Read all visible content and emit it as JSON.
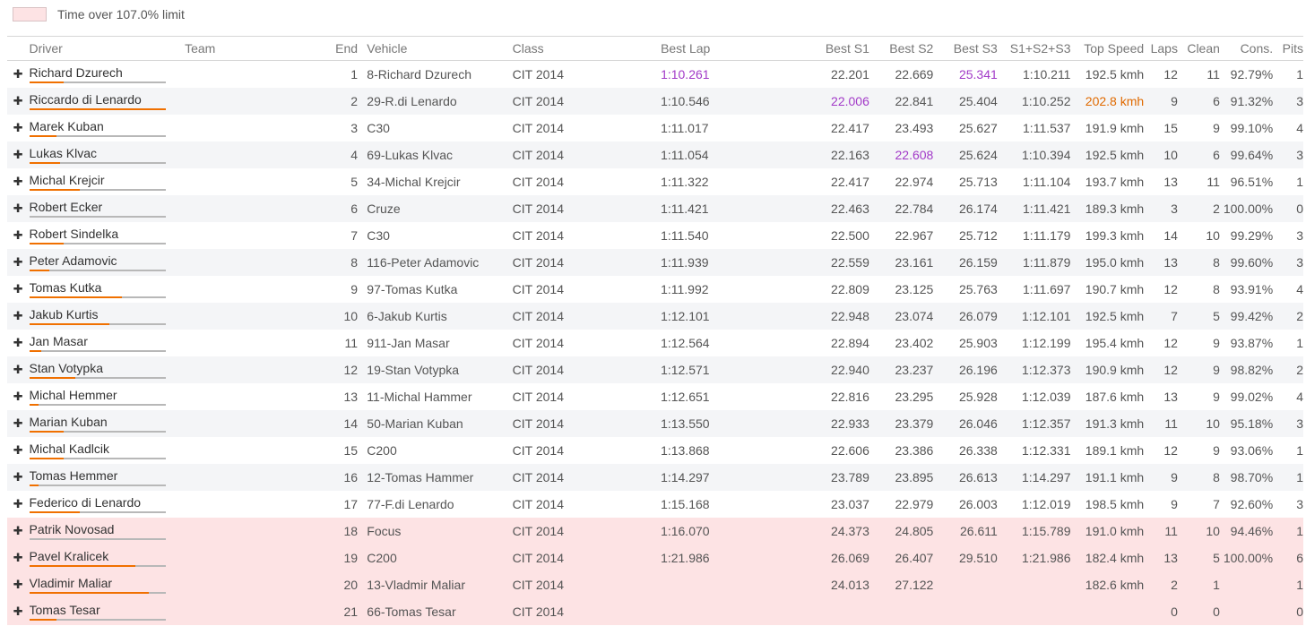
{
  "legend": {
    "label": "Time over 107.0% limit",
    "color": "#fde3e4"
  },
  "accent_colors": {
    "best_purple": "#a23ac8",
    "top_speed_orange": "#e06a00",
    "bar_fill": "#f07000"
  },
  "columns": {
    "driver": "Driver",
    "team": "Team",
    "end": "End",
    "vehicle": "Vehicle",
    "class": "Class",
    "best_lap": "Best Lap",
    "s1": "Best S1",
    "s2": "Best S2",
    "s3": "Best S3",
    "s123": "S1+S2+S3",
    "top_speed": "Top Speed",
    "laps": "Laps",
    "clean": "Clean",
    "cons": "Cons.",
    "pits": "Pits"
  },
  "rows": [
    {
      "driver": "Richard Dzurech",
      "team": "",
      "end": "1",
      "vehicle": "8-Richard Dzurech",
      "class": "CIT 2014",
      "best_lap": "1:10.261",
      "s1": "22.201",
      "s2": "22.669",
      "s3": "25.341",
      "s123": "1:10.211",
      "top_speed": "192.5 kmh",
      "laps": "12",
      "clean": "11",
      "cons": "92.79%",
      "pits": "1",
      "bar": 0.25,
      "over": false,
      "hl": [
        "best_lap",
        "s3"
      ]
    },
    {
      "driver": "Riccardo di Lenardo",
      "team": "",
      "end": "2",
      "vehicle": "29-R.di Lenardo",
      "class": "CIT 2014",
      "best_lap": "1:10.546",
      "s1": "22.006",
      "s2": "22.841",
      "s3": "25.404",
      "s123": "1:10.252",
      "top_speed": "202.8 kmh",
      "laps": "9",
      "clean": "6",
      "cons": "91.32%",
      "pits": "3",
      "bar": 1.0,
      "over": false,
      "hl": [
        "s1"
      ],
      "hl_orange": [
        "top_speed"
      ]
    },
    {
      "driver": "Marek Kuban",
      "team": "",
      "end": "3",
      "vehicle": "C30",
      "class": "CIT 2014",
      "best_lap": "1:11.017",
      "s1": "22.417",
      "s2": "23.493",
      "s3": "25.627",
      "s123": "1:11.537",
      "top_speed": "191.9 kmh",
      "laps": "15",
      "clean": "9",
      "cons": "99.10%",
      "pits": "4",
      "bar": 0.2,
      "over": false
    },
    {
      "driver": "Lukas Klvac",
      "team": "",
      "end": "4",
      "vehicle": "69-Lukas Klvac",
      "class": "CIT 2014",
      "best_lap": "1:11.054",
      "s1": "22.163",
      "s2": "22.608",
      "s3": "25.624",
      "s123": "1:10.394",
      "top_speed": "192.5 kmh",
      "laps": "10",
      "clean": "6",
      "cons": "99.64%",
      "pits": "3",
      "bar": 0.23,
      "over": false,
      "hl": [
        "s2"
      ]
    },
    {
      "driver": "Michal Krejcir",
      "team": "",
      "end": "5",
      "vehicle": "34-Michal Krejcir",
      "class": "CIT 2014",
      "best_lap": "1:11.322",
      "s1": "22.417",
      "s2": "22.974",
      "s3": "25.713",
      "s123": "1:11.104",
      "top_speed": "193.7 kmh",
      "laps": "13",
      "clean": "11",
      "cons": "96.51%",
      "pits": "1",
      "bar": 0.37,
      "over": false
    },
    {
      "driver": "Robert Ecker",
      "team": "",
      "end": "6",
      "vehicle": "Cruze",
      "class": "CIT 2014",
      "best_lap": "1:11.421",
      "s1": "22.463",
      "s2": "22.784",
      "s3": "26.174",
      "s123": "1:11.421",
      "top_speed": "189.3 kmh",
      "laps": "3",
      "clean": "2",
      "cons": "100.00%",
      "pits": "0",
      "bar": 0.0,
      "over": false
    },
    {
      "driver": "Robert Sindelka",
      "team": "",
      "end": "7",
      "vehicle": "C30",
      "class": "CIT 2014",
      "best_lap": "1:11.540",
      "s1": "22.500",
      "s2": "22.967",
      "s3": "25.712",
      "s123": "1:11.179",
      "top_speed": "199.3 kmh",
      "laps": "14",
      "clean": "10",
      "cons": "99.29%",
      "pits": "3",
      "bar": 0.25,
      "over": false
    },
    {
      "driver": "Peter Adamovic",
      "team": "",
      "end": "8",
      "vehicle": "116-Peter Adamovic",
      "class": "CIT 2014",
      "best_lap": "1:11.939",
      "s1": "22.559",
      "s2": "23.161",
      "s3": "26.159",
      "s123": "1:11.879",
      "top_speed": "195.0 kmh",
      "laps": "13",
      "clean": "8",
      "cons": "99.60%",
      "pits": "3",
      "bar": 0.15,
      "over": false
    },
    {
      "driver": "Tomas Kutka",
      "team": "",
      "end": "9",
      "vehicle": "97-Tomas Kutka",
      "class": "CIT 2014",
      "best_lap": "1:11.992",
      "s1": "22.809",
      "s2": "23.125",
      "s3": "25.763",
      "s123": "1:11.697",
      "top_speed": "190.7 kmh",
      "laps": "12",
      "clean": "8",
      "cons": "93.91%",
      "pits": "4",
      "bar": 0.68,
      "over": false
    },
    {
      "driver": "Jakub Kurtis",
      "team": "",
      "end": "10",
      "vehicle": "6-Jakub Kurtis",
      "class": "CIT 2014",
      "best_lap": "1:12.101",
      "s1": "22.948",
      "s2": "23.074",
      "s3": "26.079",
      "s123": "1:12.101",
      "top_speed": "192.5 kmh",
      "laps": "7",
      "clean": "5",
      "cons": "99.42%",
      "pits": "2",
      "bar": 0.59,
      "over": false
    },
    {
      "driver": "Jan Masar",
      "team": "",
      "end": "11",
      "vehicle": "911-Jan Masar",
      "class": "CIT 2014",
      "best_lap": "1:12.564",
      "s1": "22.894",
      "s2": "23.402",
      "s3": "25.903",
      "s123": "1:12.199",
      "top_speed": "195.4 kmh",
      "laps": "12",
      "clean": "9",
      "cons": "93.87%",
      "pits": "1",
      "bar": 0.09,
      "over": false
    },
    {
      "driver": "Stan Votypka",
      "team": "",
      "end": "12",
      "vehicle": "19-Stan Votypka",
      "class": "CIT 2014",
      "best_lap": "1:12.571",
      "s1": "22.940",
      "s2": "23.237",
      "s3": "26.196",
      "s123": "1:12.373",
      "top_speed": "190.9 kmh",
      "laps": "12",
      "clean": "9",
      "cons": "98.82%",
      "pits": "2",
      "bar": 0.34,
      "over": false
    },
    {
      "driver": "Michal Hemmer",
      "team": "",
      "end": "13",
      "vehicle": "11-Michal Hammer",
      "class": "CIT 2014",
      "best_lap": "1:12.651",
      "s1": "22.816",
      "s2": "23.295",
      "s3": "25.928",
      "s123": "1:12.039",
      "top_speed": "187.6 kmh",
      "laps": "13",
      "clean": "9",
      "cons": "99.02%",
      "pits": "4",
      "bar": 0.07,
      "over": false
    },
    {
      "driver": "Marian Kuban",
      "team": "",
      "end": "14",
      "vehicle": "50-Marian Kuban",
      "class": "CIT 2014",
      "best_lap": "1:13.550",
      "s1": "22.933",
      "s2": "23.379",
      "s3": "26.046",
      "s123": "1:12.357",
      "top_speed": "191.3 kmh",
      "laps": "11",
      "clean": "10",
      "cons": "95.18%",
      "pits": "3",
      "bar": 0.25,
      "over": false
    },
    {
      "driver": "Michal Kadlcik",
      "team": "",
      "end": "15",
      "vehicle": "C200",
      "class": "CIT 2014",
      "best_lap": "1:13.868",
      "s1": "22.606",
      "s2": "23.386",
      "s3": "26.338",
      "s123": "1:12.331",
      "top_speed": "189.1 kmh",
      "laps": "12",
      "clean": "9",
      "cons": "93.06%",
      "pits": "1",
      "bar": 0.25,
      "over": false
    },
    {
      "driver": "Tomas Hemmer",
      "team": "",
      "end": "16",
      "vehicle": "12-Tomas Hammer",
      "class": "CIT 2014",
      "best_lap": "1:14.297",
      "s1": "23.789",
      "s2": "23.895",
      "s3": "26.613",
      "s123": "1:14.297",
      "top_speed": "191.1 kmh",
      "laps": "9",
      "clean": "8",
      "cons": "98.70%",
      "pits": "1",
      "bar": 0.07,
      "over": false
    },
    {
      "driver": "Federico di Lenardo",
      "team": "",
      "end": "17",
      "vehicle": "77-F.di Lenardo",
      "class": "CIT 2014",
      "best_lap": "1:15.168",
      "s1": "23.037",
      "s2": "22.979",
      "s3": "26.003",
      "s123": "1:12.019",
      "top_speed": "198.5 kmh",
      "laps": "9",
      "clean": "7",
      "cons": "92.60%",
      "pits": "3",
      "bar": 0.37,
      "over": false
    },
    {
      "driver": "Patrik Novosad",
      "team": "",
      "end": "18",
      "vehicle": "Focus",
      "class": "CIT 2014",
      "best_lap": "1:16.070",
      "s1": "24.373",
      "s2": "24.805",
      "s3": "26.611",
      "s123": "1:15.789",
      "top_speed": "191.0 kmh",
      "laps": "11",
      "clean": "10",
      "cons": "94.46%",
      "pits": "1",
      "bar": 0.0,
      "over": true
    },
    {
      "driver": "Pavel Kralicek",
      "team": "",
      "end": "19",
      "vehicle": "C200",
      "class": "CIT 2014",
      "best_lap": "1:21.986",
      "s1": "26.069",
      "s2": "26.407",
      "s3": "29.510",
      "s123": "1:21.986",
      "top_speed": "182.4 kmh",
      "laps": "13",
      "clean": "5",
      "cons": "100.00%",
      "pits": "6",
      "bar": 0.78,
      "over": true
    },
    {
      "driver": "Vladimir Maliar",
      "team": "",
      "end": "20",
      "vehicle": "13-Vladmir Maliar",
      "class": "CIT 2014",
      "best_lap": "",
      "s1": "24.013",
      "s2": "27.122",
      "s3": "",
      "s123": "",
      "top_speed": "182.6 kmh",
      "laps": "2",
      "clean": "1",
      "cons": "",
      "pits": "1",
      "bar": 0.88,
      "over": true
    },
    {
      "driver": "Tomas Tesar",
      "team": "",
      "end": "21",
      "vehicle": "66-Tomas Tesar",
      "class": "CIT 2014",
      "best_lap": "",
      "s1": "",
      "s2": "",
      "s3": "",
      "s123": "",
      "top_speed": "",
      "laps": "0",
      "clean": "0",
      "cons": "",
      "pits": "0",
      "bar": 0.2,
      "over": true
    }
  ]
}
